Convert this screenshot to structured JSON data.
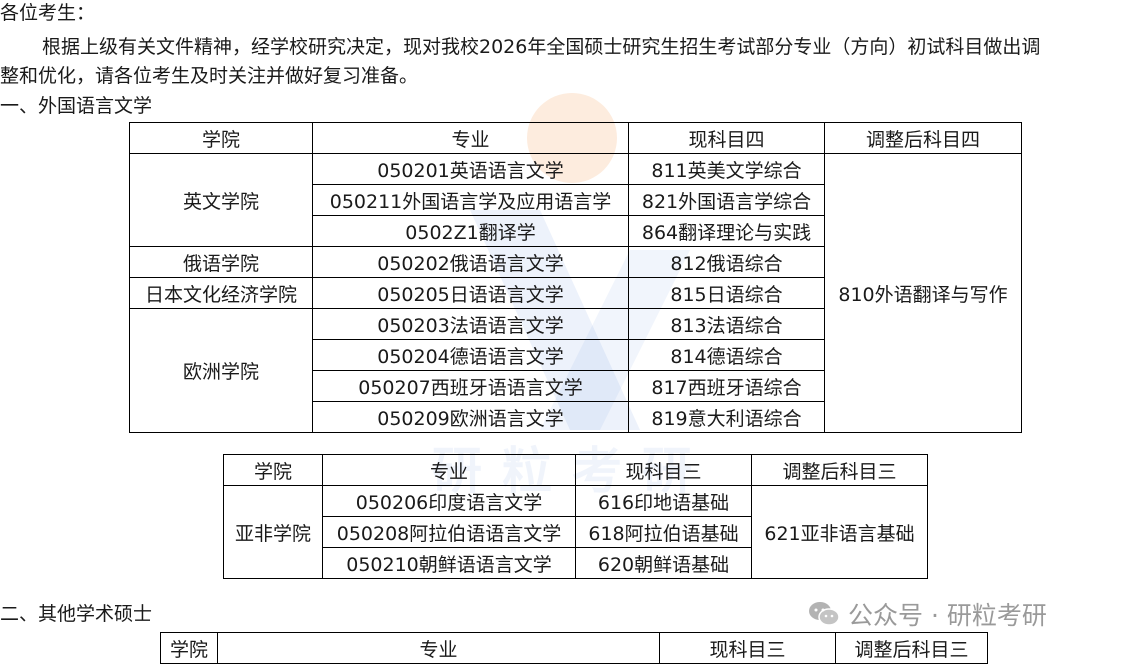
{
  "greeting": "各位考生：",
  "intro_line1": "根据上级有关文件精神，经学校研究决定，现对我校2026年全国硕士研究生招生考试部分专业（方向）初试科目做出调",
  "intro_line2": "整和优化，请各位考生及时关注并做好复习准备。",
  "section1": {
    "heading": "一、外国语言文学",
    "table1": {
      "headers": [
        "学院",
        "专业",
        "现科目四",
        "调整后科目四"
      ],
      "colleges": [
        "英文学院",
        "俄语学院",
        "日本文化经济学院",
        "欧洲学院"
      ],
      "majors": [
        "050201英语语言文学",
        "050211外国语言学及应用语言学",
        "0502Z1翻译学",
        "050202俄语语言文学",
        "050205日语语言文学",
        "050203法语语言文学",
        "050204德语语言文学",
        "050207西班牙语语言文学",
        "050209欧洲语言文学"
      ],
      "current": [
        "811英美文学综合",
        "821外国语言学综合",
        "864翻译理论与实践",
        "812俄语综合",
        "815日语综合",
        "813法语综合",
        "814德语综合",
        "817西班牙语综合",
        "819意大利语综合"
      ],
      "adjusted": "810外语翻译与写作"
    },
    "table2": {
      "headers": [
        "学院",
        "专业",
        "现科目三",
        "调整后科目三"
      ],
      "college": "亚非学院",
      "majors": [
        "050206印度语言文学",
        "050208阿拉伯语语言文学",
        "050210朝鲜语语言文学"
      ],
      "current": [
        "616印地语基础",
        "618阿拉伯语基础",
        "620朝鲜语基础"
      ],
      "adjusted": "621亚非语言基础"
    }
  },
  "section2": {
    "heading": "二、其他学术硕士",
    "table3": {
      "headers": [
        "学院",
        "专业",
        "现科目三",
        "调整后科目三"
      ]
    }
  },
  "watermark": {
    "text": "公众号 · 研粒考研",
    "logo_text": "研粒考研",
    "accent_colors": {
      "orange": "#f6a96a",
      "blue": "#4b7bd8",
      "gray": "#9a9a9a"
    }
  }
}
